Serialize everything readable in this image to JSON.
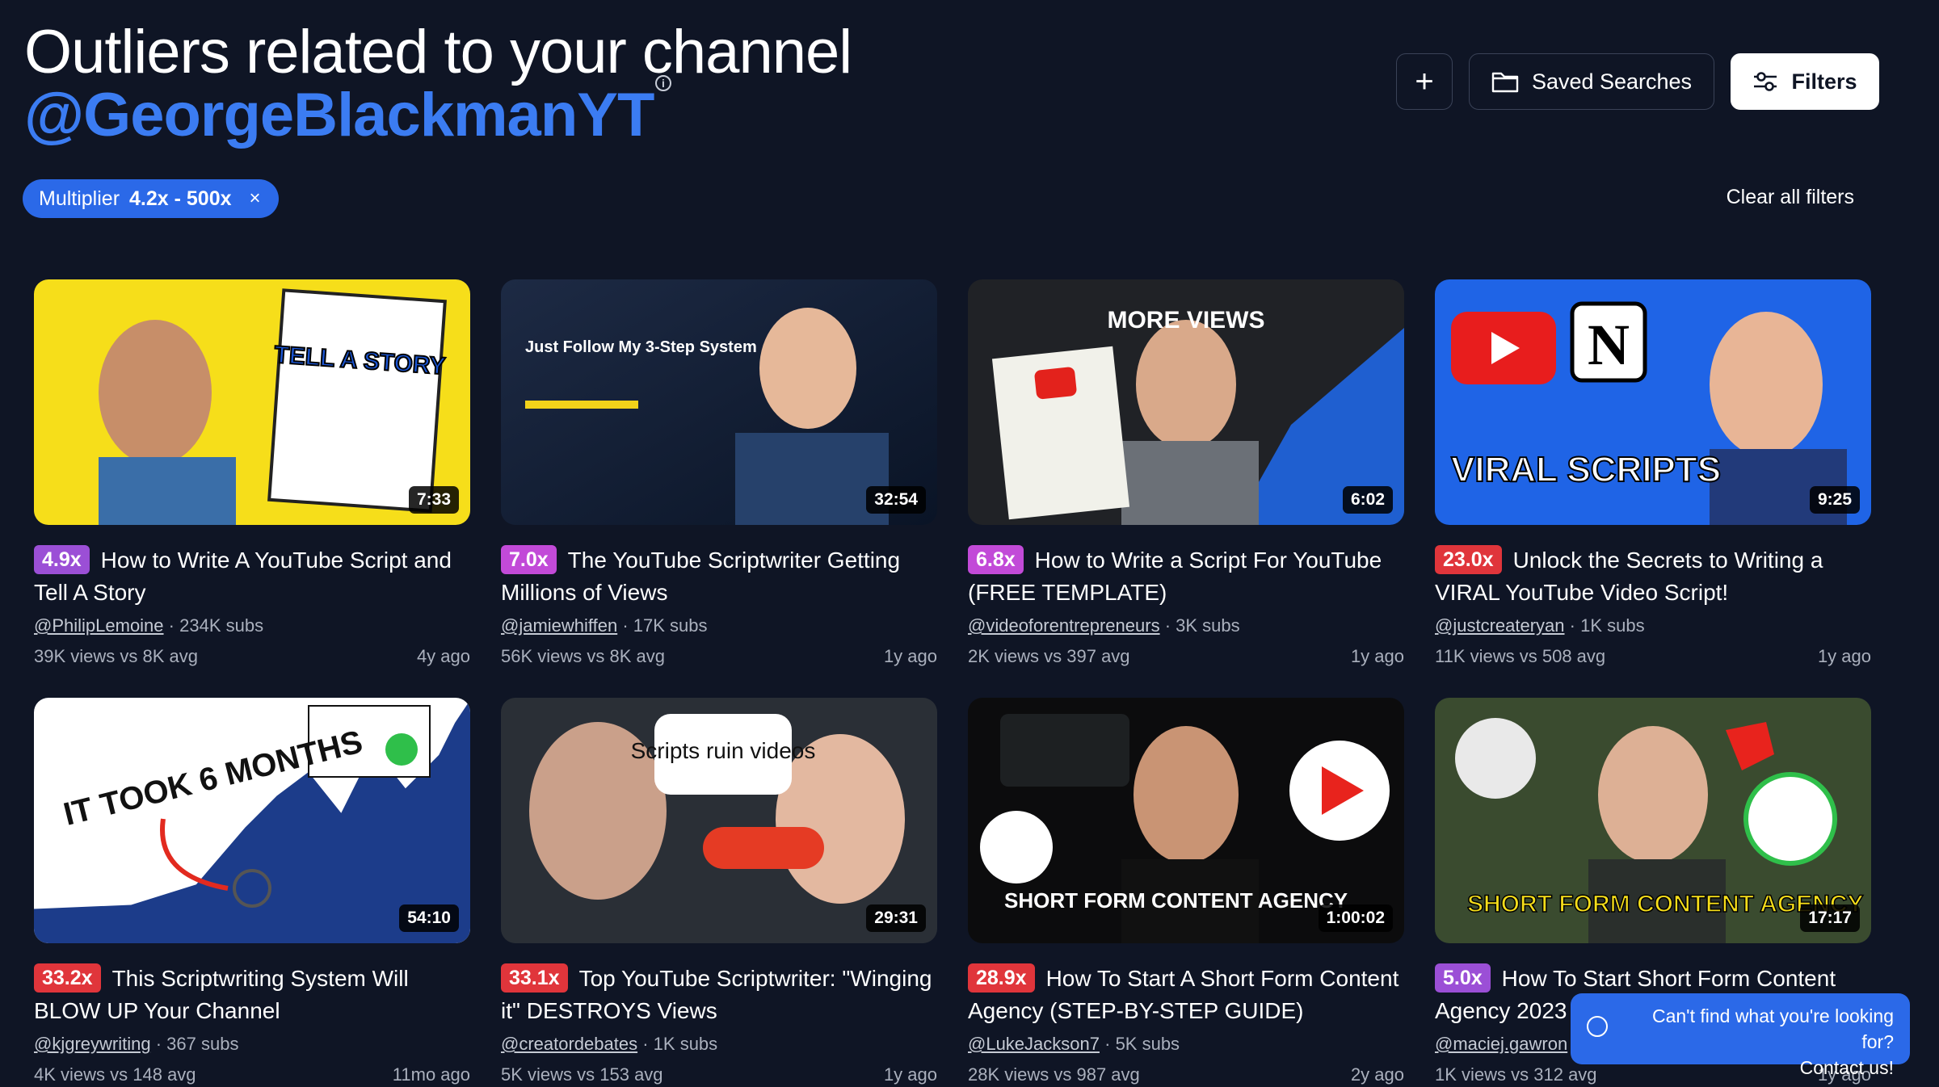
{
  "header": {
    "title": "Outliers related to your channel",
    "handle": "@GeorgeBlackmanYT",
    "info_icon": "i",
    "add_label": "+",
    "saved_label": "Saved Searches",
    "filters_label": "Filters"
  },
  "filter_chip": {
    "label": "Multiplier",
    "value": "4.2x - 500x",
    "remove": "×"
  },
  "clear_all": "Clear all filters",
  "videos": [
    {
      "multiplier": "4.9x",
      "mult_color": "#9b4fd6",
      "title": "How to Write A YouTube Script and Tell A Story",
      "channel": "@PhilipLemoine",
      "subs": "234K subs",
      "views": "39K views vs 8K avg",
      "age": "4y ago",
      "duration": "7:33",
      "thumb_text": "TELL A STORY"
    },
    {
      "multiplier": "7.0x",
      "mult_color": "#c24ad8",
      "title": "The YouTube Scriptwriter Getting Millions of Views",
      "channel": "@jamiewhiffen",
      "subs": "17K subs",
      "views": "56K views vs 8K avg",
      "age": "1y ago",
      "duration": "32:54",
      "thumb_text": "Just Follow My 3-Step System"
    },
    {
      "multiplier": "6.8x",
      "mult_color": "#c24ad8",
      "title": "How to Write a Script For YouTube (FREE TEMPLATE)",
      "channel": "@videoforentrepreneurs",
      "subs": "3K subs",
      "views": "2K views vs 397 avg",
      "age": "1y ago",
      "duration": "6:02",
      "thumb_text": "MORE VIEWS"
    },
    {
      "multiplier": "23.0x",
      "mult_color": "#e0353b",
      "title": "Unlock the Secrets to Writing a VIRAL YouTube Video Script!",
      "channel": "@justcreateryan",
      "subs": "1K subs",
      "views": "11K views vs 508 avg",
      "age": "1y ago",
      "duration": "9:25",
      "thumb_text": "VIRAL SCRIPTS"
    },
    {
      "multiplier": "33.2x",
      "mult_color": "#e0353b",
      "title": "This Scriptwriting System Will BLOW UP Your Channel",
      "channel": "@kjgreywriting",
      "subs": "367 subs",
      "views": "4K views vs 148 avg",
      "age": "11mo ago",
      "duration": "54:10",
      "thumb_text": "IT TOOK 6 MONTHS"
    },
    {
      "multiplier": "33.1x",
      "mult_color": "#e0353b",
      "title": "Top YouTube Scriptwriter: \"Winging it\" DESTROYS Views",
      "channel": "@creatordebates",
      "subs": "1K subs",
      "views": "5K views vs 153 avg",
      "age": "1y ago",
      "duration": "29:31",
      "thumb_text": "Scripts ruin videos"
    },
    {
      "multiplier": "28.9x",
      "mult_color": "#e0353b",
      "title": "How To Start A Short Form Content Agency (STEP-BY-STEP GUIDE)",
      "channel": "@LukeJackson7",
      "subs": "5K subs",
      "views": "28K views vs 987 avg",
      "age": "2y ago",
      "duration": "1:00:02",
      "thumb_text": "SHORT FORM CONTENT AGENCY"
    },
    {
      "multiplier": "5.0x",
      "mult_color": "#9b4fd6",
      "title": "How To Start Short Form Content Agency 2023",
      "channel": "@maciej.gawron",
      "subs": "",
      "views": "1K views vs 312 avg",
      "age": "1y ago",
      "duration": "17:17",
      "thumb_text": "SHORT FORM CONTENT AGENCY"
    }
  ],
  "contact": {
    "line1": "Can't find what you're looking for?",
    "line2": "Contact us!"
  },
  "colors": {
    "background": "#0f1525",
    "accent": "#2b69e8",
    "handle": "#3b7cf2"
  }
}
